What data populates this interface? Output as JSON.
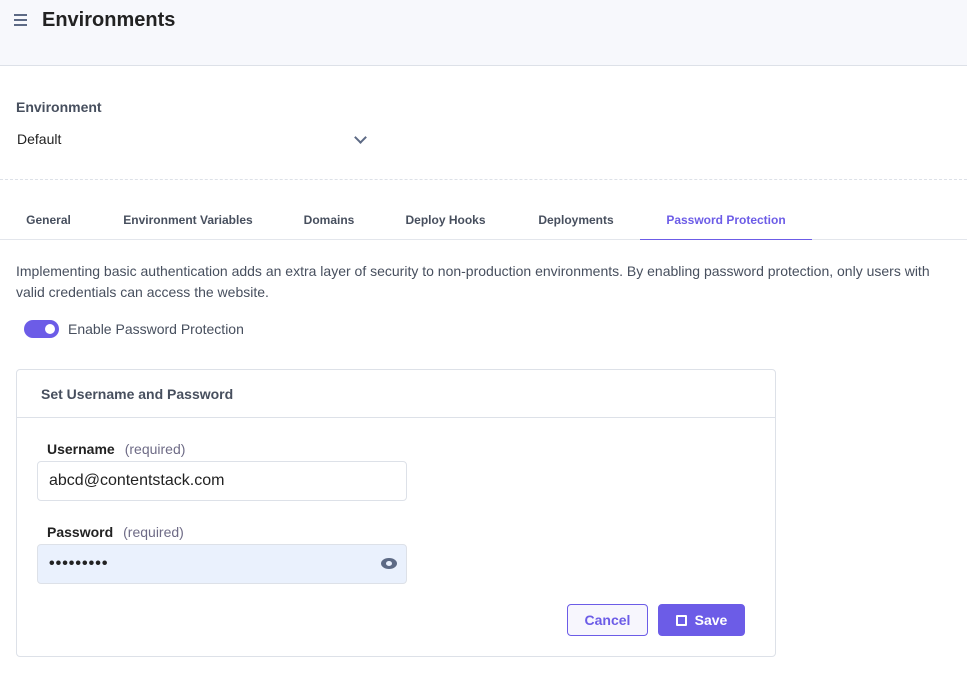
{
  "header": {
    "title": "Environments",
    "menu_icon": "hamburger-icon"
  },
  "environment": {
    "label": "Environment",
    "selected": "Default"
  },
  "tabs": [
    {
      "label": "General"
    },
    {
      "label": "Environment Variables"
    },
    {
      "label": "Domains"
    },
    {
      "label": "Deploy Hooks"
    },
    {
      "label": "Deployments"
    },
    {
      "label": "Password Protection",
      "active": true
    }
  ],
  "description": "Implementing basic authentication adds an extra layer of security to non-production environments. By enabling password protection, only users with valid credentials can access the website.",
  "toggle": {
    "label": "Enable Password Protection",
    "enabled": true
  },
  "card": {
    "title": "Set Username and Password",
    "username": {
      "label": "Username",
      "hint": "(required)",
      "value": "abcd@contentstack.com"
    },
    "password": {
      "label": "Password",
      "hint": "(required)",
      "value": "•••••••••"
    },
    "cancel_label": "Cancel",
    "save_label": "Save"
  },
  "colors": {
    "accent": "#6c5ce7",
    "header_bg": "#f7f8fc",
    "password_bg": "#eaf1fd"
  }
}
